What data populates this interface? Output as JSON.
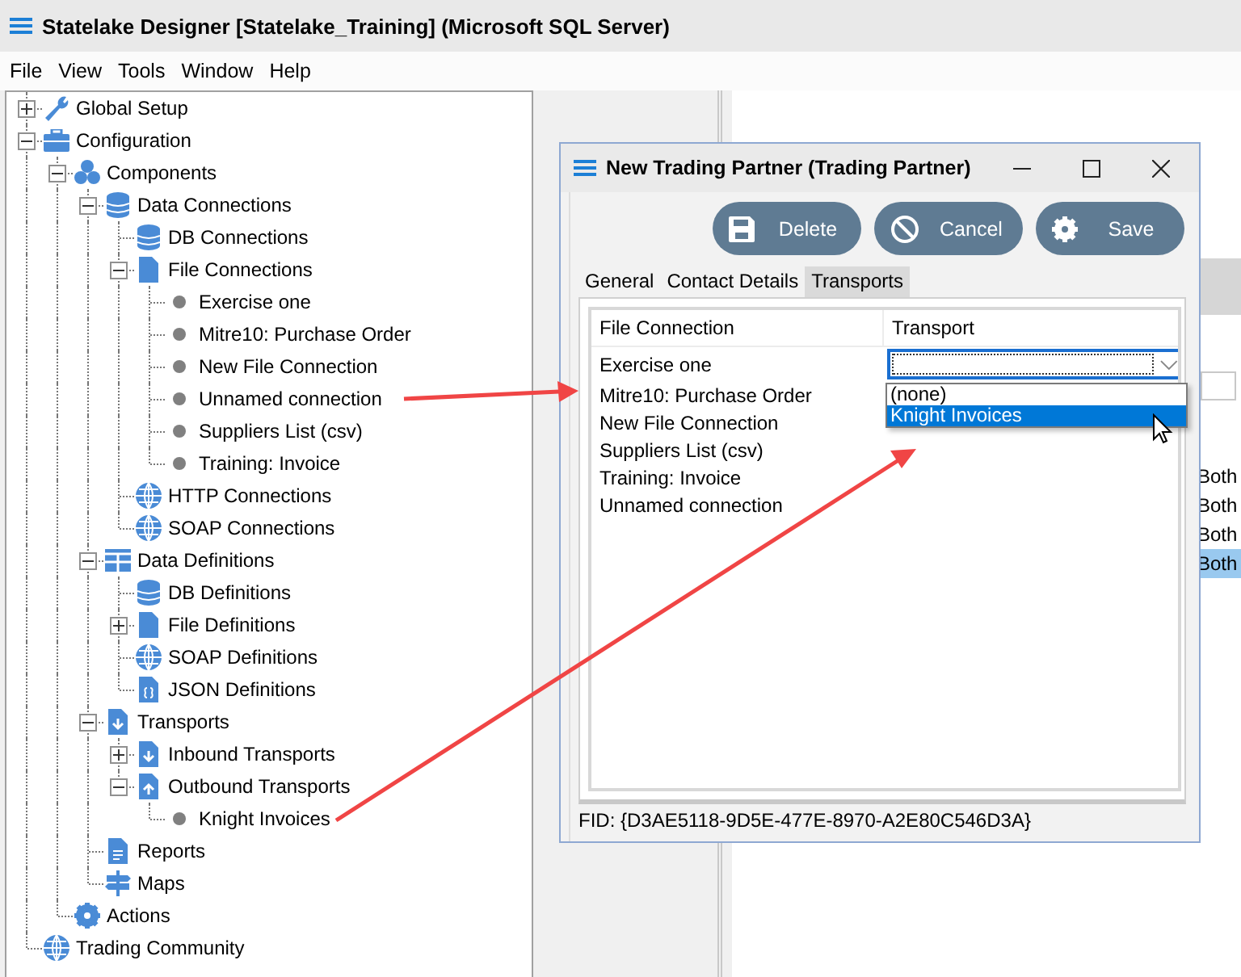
{
  "window": {
    "title": "Statelake Designer [Statelake_Training] (Microsoft SQL Server)"
  },
  "menu": [
    "File",
    "View",
    "Tools",
    "Window",
    "Help"
  ],
  "tree": [
    {
      "label": "Global Setup",
      "kind": "wrench",
      "expanded": false
    },
    {
      "label": "Configuration",
      "kind": "toolbox",
      "expanded": true,
      "children": [
        {
          "label": "Components",
          "kind": "cubes",
          "expanded": true,
          "children": [
            {
              "label": "Data Connections",
              "kind": "database",
              "expanded": true,
              "children": [
                {
                  "label": "DB Connections",
                  "kind": "database"
                },
                {
                  "label": "File Connections",
                  "kind": "file",
                  "expanded": true,
                  "children": [
                    {
                      "label": "Exercise one",
                      "kind": "bullet"
                    },
                    {
                      "label": "Mitre10: Purchase Order",
                      "kind": "bullet"
                    },
                    {
                      "label": "New File Connection",
                      "kind": "bullet"
                    },
                    {
                      "label": "Unnamed connection",
                      "kind": "bullet"
                    },
                    {
                      "label": "Suppliers List (csv)",
                      "kind": "bullet"
                    },
                    {
                      "label": "Training: Invoice",
                      "kind": "bullet"
                    }
                  ]
                },
                {
                  "label": "HTTP Connections",
                  "kind": "globe"
                },
                {
                  "label": "SOAP Connections",
                  "kind": "globe"
                }
              ]
            },
            {
              "label": "Data Definitions",
              "kind": "grid",
              "expanded": true,
              "children": [
                {
                  "label": "DB Definitions",
                  "kind": "database"
                },
                {
                  "label": "File Definitions",
                  "kind": "file",
                  "expanded": false
                },
                {
                  "label": "SOAP Definitions",
                  "kind": "globe"
                },
                {
                  "label": "JSON Definitions",
                  "kind": "json"
                }
              ]
            },
            {
              "label": "Transports",
              "kind": "download",
              "expanded": true,
              "children": [
                {
                  "label": "Inbound Transports",
                  "kind": "download",
                  "expanded": false
                },
                {
                  "label": "Outbound Transports",
                  "kind": "upload",
                  "expanded": true,
                  "children": [
                    {
                      "label": "Knight Invoices",
                      "kind": "bullet"
                    }
                  ]
                }
              ]
            },
            {
              "label": "Reports",
              "kind": "report"
            },
            {
              "label": "Maps",
              "kind": "map"
            }
          ]
        },
        {
          "label": "Actions",
          "kind": "gear"
        }
      ]
    },
    {
      "label": "Trading Community",
      "kind": "globe"
    }
  ],
  "background_table": {
    "rows": [
      {
        "text": "Both",
        "selected": false
      },
      {
        "text": "Both",
        "selected": false
      },
      {
        "text": "Both",
        "selected": false
      },
      {
        "text": "Both",
        "selected": true
      }
    ]
  },
  "dialog": {
    "title": "New Trading Partner (Trading Partner)",
    "buttons": [
      {
        "label": "Delete",
        "kind": "disk"
      },
      {
        "label": "Cancel",
        "kind": "ban"
      },
      {
        "label": "Save",
        "kind": "gear"
      }
    ],
    "tabs": [
      {
        "label": "General",
        "selected": false
      },
      {
        "label": "Contact Details",
        "selected": false
      },
      {
        "label": "Transports",
        "selected": true
      }
    ],
    "columns": [
      "File Connection",
      "Transport"
    ],
    "rows": [
      {
        "file_connection": "Exercise one",
        "editing": true
      },
      {
        "file_connection": "Mitre10: Purchase Order",
        "editing": false
      },
      {
        "file_connection": "New File Connection",
        "editing": false
      },
      {
        "file_connection": "Suppliers List (csv)",
        "editing": false
      },
      {
        "file_connection": "Training: Invoice",
        "editing": false
      },
      {
        "file_connection": "Unnamed connection",
        "editing": false
      }
    ],
    "dropdown_options": [
      {
        "label": "(none)",
        "selected": false
      },
      {
        "label": "Knight Invoices",
        "selected": true
      }
    ],
    "fid": "FID: {D3AE5118-9D5E-477E-8970-A2E80C546D3A}"
  }
}
